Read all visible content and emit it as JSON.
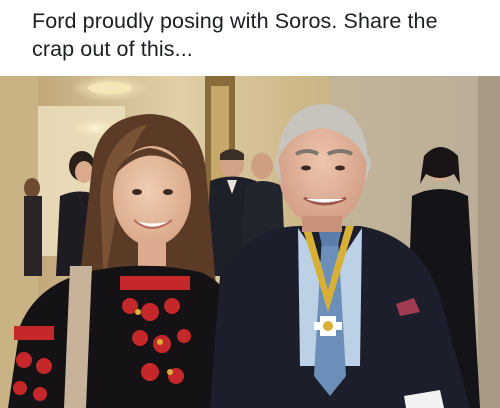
{
  "post": {
    "caption": "Ford proudly posing with Soros. Share the crap out of this..."
  },
  "photo": {
    "description": "",
    "palette": {
      "wall": "#d8c7a3",
      "wall_shadow": "#a08a62",
      "ceiling_light": "#f4e6b8",
      "hair_light": "#c7c3bd",
      "hair_brown": "#5b3b25",
      "suit_dark": "#1c1f2b",
      "blouse_black": "#141214",
      "embroidery_red": "#c5282a",
      "embroidery_gold": "#d8b035",
      "tie_blue": "#6b8fb8",
      "skin": "#e3b79a"
    }
  }
}
